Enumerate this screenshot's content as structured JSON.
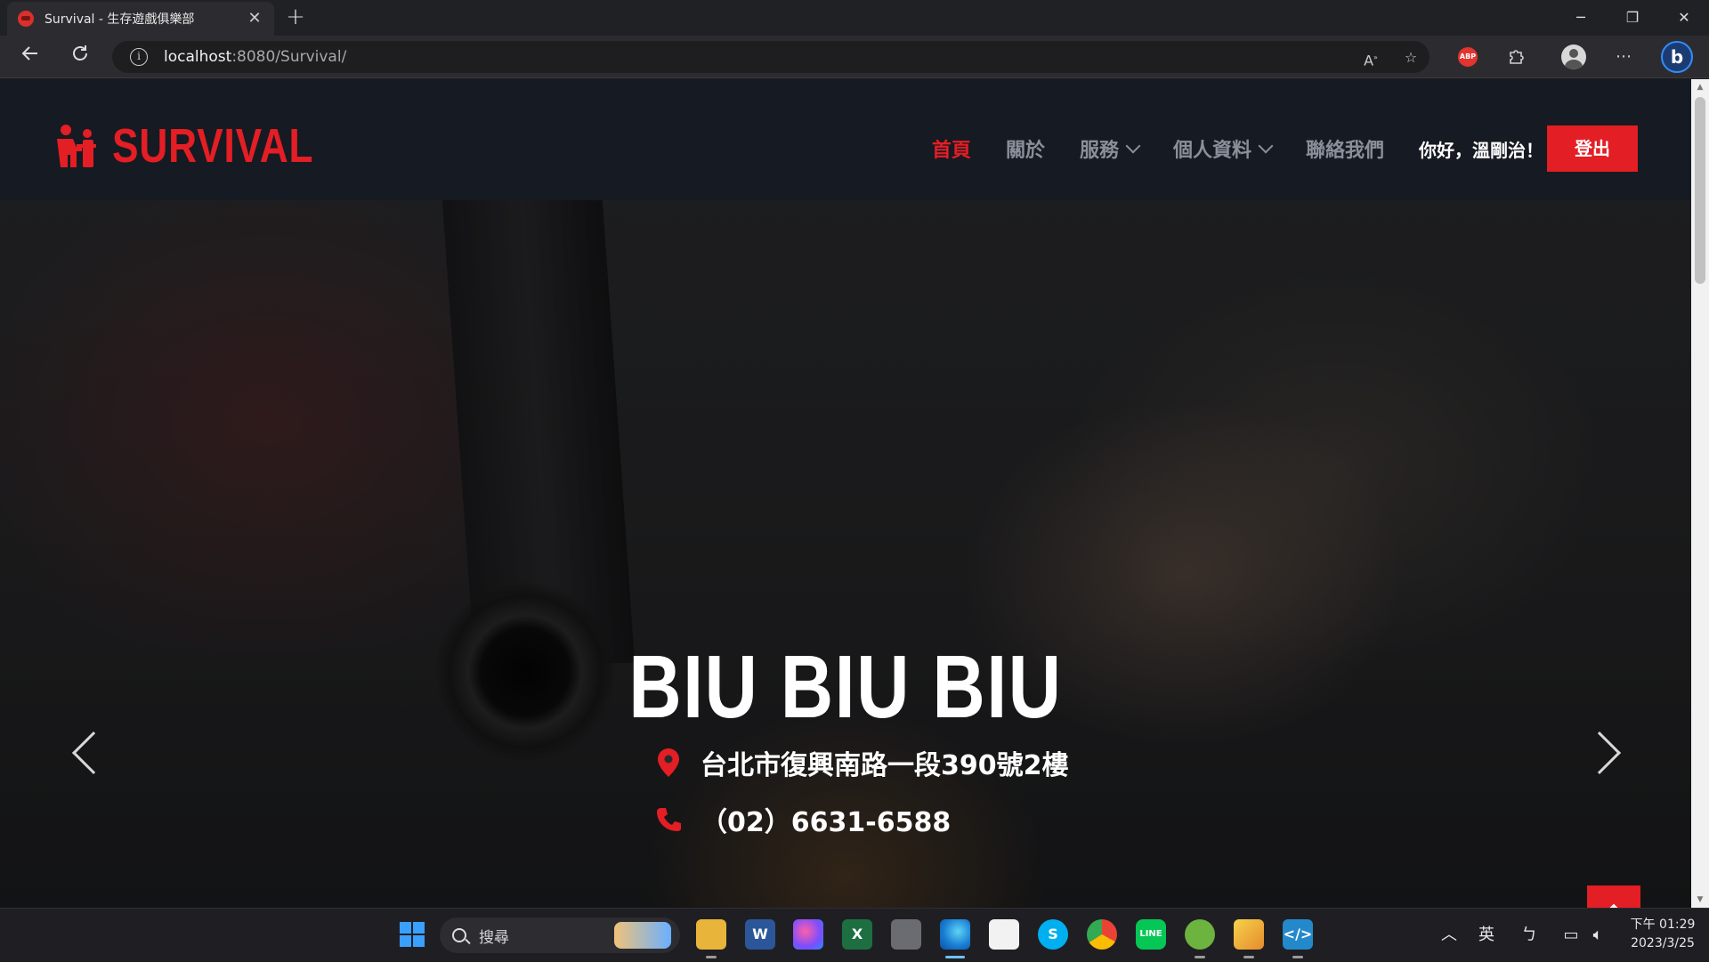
{
  "browser": {
    "tab_title": "Survival - 生存遊戲俱樂部",
    "tab_close": "✕",
    "new_tab": "+",
    "url_host": "localhost",
    "url_path": ":8080/Survival/",
    "window_controls": {
      "minimize": "─",
      "restore": "❐",
      "close": "✕"
    }
  },
  "site": {
    "brand": "SURVIVAL",
    "accent_color": "#e31e24",
    "nav": [
      {
        "label": "首頁",
        "active": true
      },
      {
        "label": "關於"
      },
      {
        "label": "服務",
        "dropdown": true
      },
      {
        "label": "個人資料",
        "dropdown": true
      },
      {
        "label": "聯絡我們"
      }
    ],
    "greeting": "你好，溫剛治！",
    "logout_label": "登出"
  },
  "hero": {
    "title": "BIU BIU BIU",
    "address": "台北市復興南路一段390號2樓",
    "phone": "（02）6631-6588"
  },
  "taskbar": {
    "search_placeholder": "搜尋",
    "ime": "英",
    "time": "下午 01:29",
    "date": "2023/3/25"
  }
}
